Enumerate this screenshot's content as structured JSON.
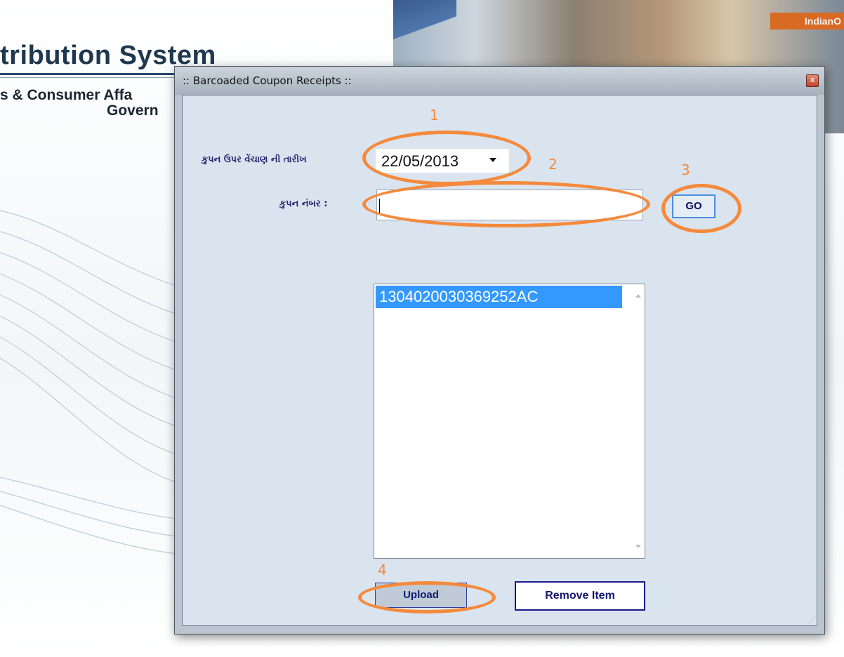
{
  "background": {
    "title": "tribution System",
    "subtitle_line1": "s & Consumer Affa",
    "subtitle_line2": "Govern",
    "sign_text": "IndianO"
  },
  "dialog": {
    "title": ":: Barcoaded Coupon Receipts ::",
    "close_glyph": "x",
    "date_label": "કુપન ઉપર વેંચાણ ની તારીખ",
    "date_value": "22/05/2013",
    "coupon_label": "કુપન નંબર :",
    "coupon_value": "",
    "go_label": "GO",
    "list_items": [
      "1304020030369252AC"
    ],
    "upload_label": "Upload",
    "remove_label": "Remove Item"
  },
  "annotations": [
    "1",
    "2",
    "3",
    "4"
  ],
  "colors": {
    "annotation": "#f58a3c",
    "selection": "#3399ff",
    "client_bg": "#dae4ef",
    "button_text": "#12126e"
  }
}
